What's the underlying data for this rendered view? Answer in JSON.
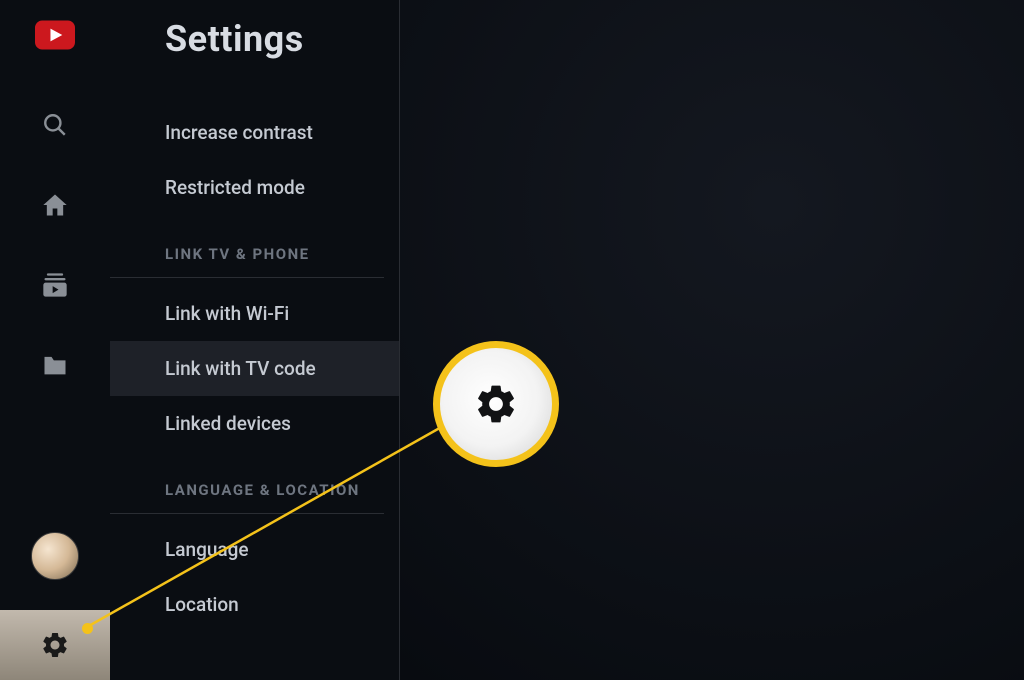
{
  "header": {
    "title": "Settings"
  },
  "settings": {
    "items": [
      {
        "label": "Increase contrast",
        "selected": false
      },
      {
        "label": "Restricted mode",
        "selected": false
      }
    ],
    "sections": [
      {
        "header": "LINK TV & PHONE",
        "items": [
          {
            "label": "Link with Wi-Fi",
            "selected": false
          },
          {
            "label": "Link with TV code",
            "selected": true
          },
          {
            "label": "Linked devices",
            "selected": false
          }
        ]
      },
      {
        "header": "LANGUAGE & LOCATION",
        "items": [
          {
            "label": "Language",
            "selected": false
          },
          {
            "label": "Location",
            "selected": false
          }
        ]
      }
    ]
  },
  "sidebar": {
    "icons": {
      "youtube": "youtube-logo",
      "search": "search-icon",
      "home": "home-icon",
      "subscriptions": "subscriptions-icon",
      "library": "library-icon",
      "avatar": "avatar",
      "settings": "gear-icon"
    }
  },
  "callout": {
    "target": "settings-nav-item",
    "icon": "gear-icon"
  },
  "colors": {
    "youtube_red": "#cc181e",
    "accent_yellow": "#f4c21a",
    "bg_dark": "#0a0d12",
    "text_primary": "#d8dce3",
    "text_secondary": "#c5cad2",
    "text_muted": "#6e7580"
  }
}
